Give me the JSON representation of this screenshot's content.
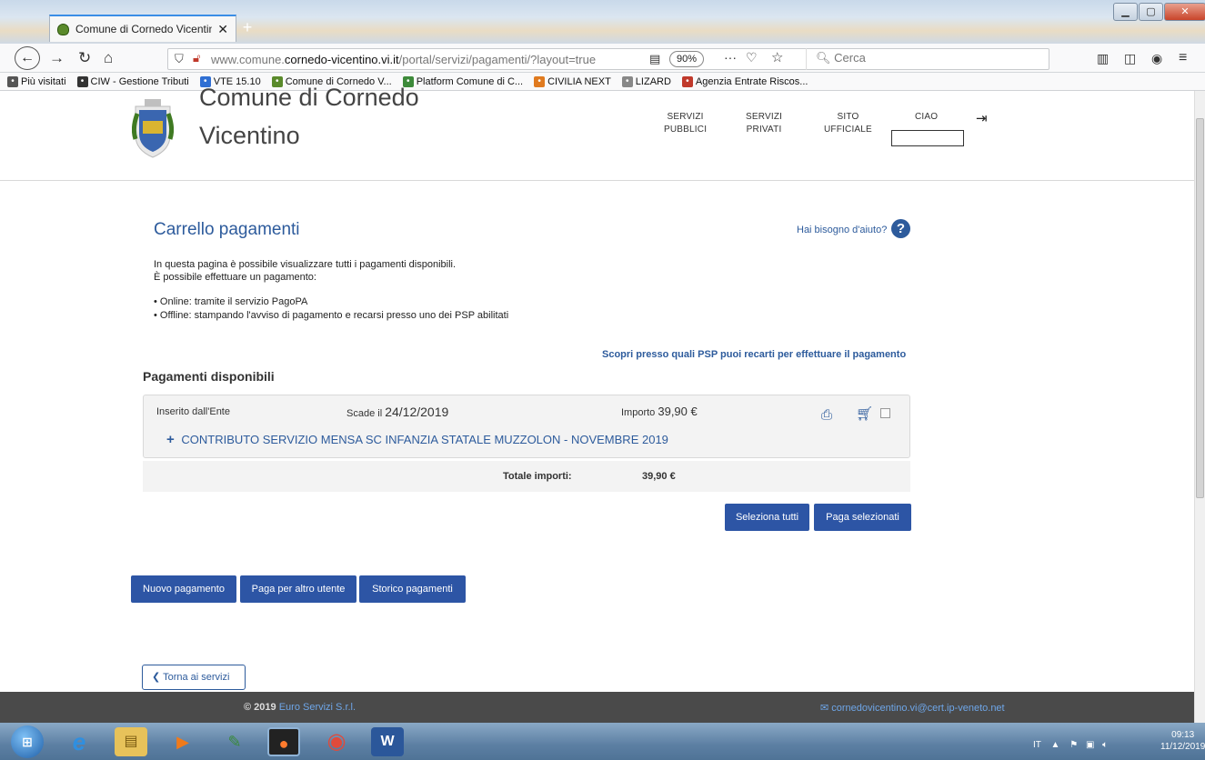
{
  "browser": {
    "tab_title": "Comune di Cornedo Vicentino",
    "tab_close": "✕",
    "url_prefix": "www.comune.",
    "url_domain": "cornedo-vicentino.vi.it",
    "url_path": "/portal/servizi/pagamenti/?layout=true",
    "zoom": "90%",
    "search_placeholder": "Cerca",
    "bookmarks": [
      {
        "label": "Più visitati",
        "icon": "gear-icon",
        "color": "#555555"
      },
      {
        "label": "CIW - Gestione Tributi",
        "icon": "globe-icon",
        "color": "#333333"
      },
      {
        "label": "VTE 15.10",
        "icon": "chrome-icon",
        "color": "#2f6fd3"
      },
      {
        "label": "Comune di Cornedo V...",
        "icon": "crest-icon",
        "color": "#5a8a2b"
      },
      {
        "label": "Platform Comune di C...",
        "icon": "platform-icon",
        "color": "#3d8a3a"
      },
      {
        "label": "CIVILIA NEXT",
        "icon": "civilia-icon",
        "color": "#e07a1f"
      },
      {
        "label": "LIZARD",
        "icon": "lizard-icon",
        "color": "#888888"
      },
      {
        "label": "Agenzia Entrate Riscos...",
        "icon": "ae-icon",
        "color": "#c0392b"
      }
    ]
  },
  "header": {
    "site_line1": "Comune di Cornedo",
    "site_line2": "Vicentino",
    "nav": [
      {
        "l1": "SERVIZI",
        "l2": "PUBBLICI"
      },
      {
        "l1": "SERVIZI",
        "l2": "PRIVATI"
      },
      {
        "l1": "SITO",
        "l2": "UFFICIALE"
      }
    ],
    "greeting": "CIAO"
  },
  "main": {
    "title": "Carrello pagamenti",
    "help_text": "Hai bisogno d'aiuto?",
    "intro1": "In questa pagina è possibile visualizzare tutti i pagamenti disponibili.",
    "intro2": "È possibile effettuare un pagamento:",
    "bullet1": "• Online: tramite il servizio PagoPA",
    "bullet2": "• Offline: stampando l'avviso di pagamento e recarsi presso uno dei PSP abilitati",
    "psp_link": "Scopri presso quali PSP puoi recarti per effettuare il pagamento",
    "section_title": "Pagamenti disponibili",
    "payment": {
      "source": "Inserito dall'Ente",
      "due_label": "Scade il",
      "due_date": "24/12/2019",
      "amount_label": "Importo",
      "amount": "39,90 €",
      "plus": "+",
      "description": "CONTRIBUTO SERVIZIO MENSA SC INFANZIA STATALE MUZZOLON - NOVEMBRE 2019"
    },
    "total_label": "Totale importi:",
    "total_value": "39,90 €",
    "btn_select_all": "Seleziona tutti",
    "btn_pay_selected": "Paga selezionati",
    "btn_new": "Nuovo pagamento",
    "btn_other_user": "Paga per altro utente",
    "btn_history": "Storico pagamenti",
    "back_link": "Torna ai servizi"
  },
  "footer": {
    "copyright": "© 2019",
    "company": "Euro Servizi S.r.l.",
    "email": "cornedovicentino.vi@cert.ip-veneto.net"
  },
  "taskbar": {
    "lang": "IT",
    "time": "09:13",
    "date": "11/12/2019"
  }
}
